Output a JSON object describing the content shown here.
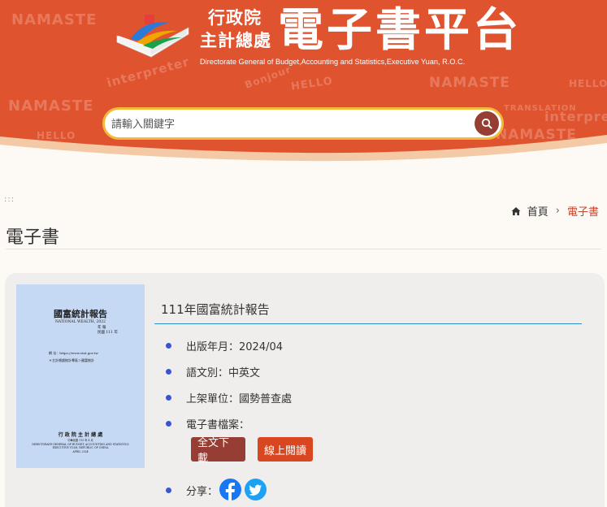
{
  "header": {
    "org_line1": "行政院",
    "org_line2": "主計總處",
    "platform_title": "電子書平台",
    "subtitle_en": "Directorate General of Budget,Accounting and Statistics,Executive Yuan, R.O.C.",
    "doodles": [
      "NAMASTE",
      "interpreter",
      "NAMASTE",
      "HELLO",
      "TRANSLATION",
      "interpret",
      "HELLO",
      "NAMASTE",
      "Bonjour",
      "HELLO",
      "NAMASTE"
    ],
    "colors": {
      "header_bg": "#e0532f",
      "header_curve": "#f3c9a6",
      "search_border": "#f2b93b",
      "search_button": "#963e34"
    }
  },
  "search": {
    "placeholder": "請輸入關鍵字",
    "icon": "search-icon"
  },
  "breadcrumb": {
    "decor": ":::",
    "home_label": "首頁",
    "separator": "›",
    "current": "電子書"
  },
  "page": {
    "title": "電子書"
  },
  "book": {
    "title": "111年國富統計報告",
    "cover": {
      "title": "國富統計報告",
      "subtitle": "NATIONAL WEALTH, 2022",
      "year_line1": "年 報",
      "year_line2": "民國 111 年",
      "line1": "網 址：https://www.stat.gov.tw",
      "line2": "＊主計總處統計專區＞國富統計",
      "publisher": "行 政 院 主 計 總 處",
      "publisher_sub": "中華民國 113 年 4 月",
      "publisher_en1": "DIRECTORATE-GENERAL OF BUDGET, ACCOUNTING AND STATISTICS",
      "publisher_en2": "EXECUTIVE YUAN, REPUBLIC OF CHINA",
      "publisher_en3": "APRIL 2024",
      "bg_color": "#c5d8f4"
    },
    "published_label": "出版年月：2024/04",
    "language_label": "語文別：中英文",
    "publisher_label": "上架單位：國勢普查處",
    "file_label": "電子書檔案：",
    "download_button": "全文下載",
    "read_button": "線上閱讀",
    "share_label": "分享：",
    "share_icons": [
      "facebook-icon",
      "twitter-icon"
    ],
    "colors": {
      "download": "#963e34",
      "read": "#d8471f",
      "bullet": "#3857c9",
      "rule": "#2f8ec2"
    }
  }
}
